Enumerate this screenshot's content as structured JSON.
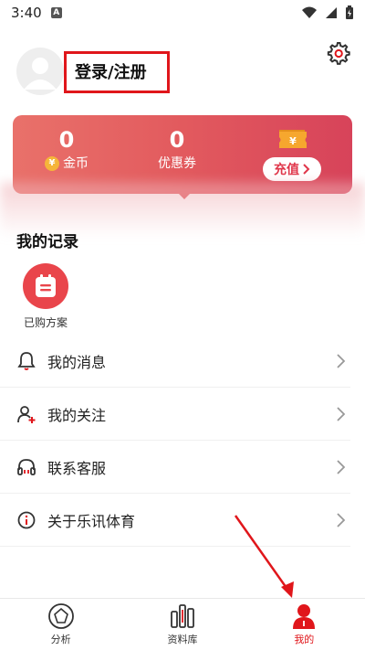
{
  "status_bar": {
    "time": "3:40",
    "notif_letter": "A"
  },
  "profile": {
    "login_label": "登录/注册"
  },
  "wallet": {
    "coins_value": "0",
    "coins_label": "金币",
    "coupons_value": "0",
    "coupons_label": "优惠券",
    "recharge_label": "充值",
    "coin_symbol": "¥"
  },
  "records": {
    "title": "我的记录",
    "items": [
      {
        "label": "已购方案"
      }
    ]
  },
  "menu": {
    "items": [
      {
        "label": "我的消息",
        "icon": "bell-icon"
      },
      {
        "label": "我的关注",
        "icon": "user-follow-icon"
      },
      {
        "label": "联系客服",
        "icon": "headset-icon"
      },
      {
        "label": "关于乐讯体育",
        "icon": "info-icon"
      }
    ]
  },
  "tabs": [
    {
      "label": "分析",
      "icon": "analysis-icon",
      "active": false
    },
    {
      "label": "资料库",
      "icon": "database-icon",
      "active": false
    },
    {
      "label": "我的",
      "icon": "profile-icon",
      "active": true
    }
  ],
  "colors": {
    "accent": "#e0161b",
    "card_start": "#e9716a",
    "card_end": "#d7435a"
  }
}
